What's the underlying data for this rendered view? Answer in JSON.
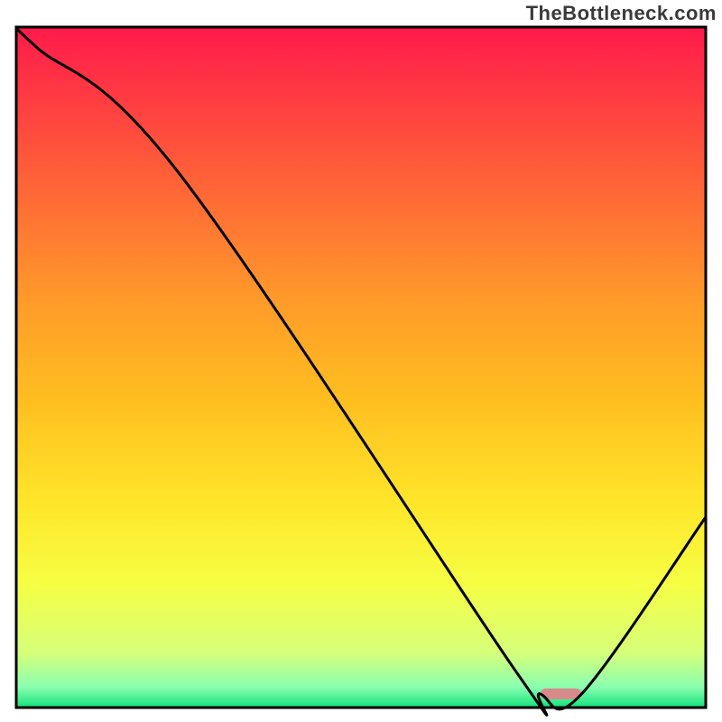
{
  "watermark": "TheBottleneck.com",
  "chart_data": {
    "type": "line",
    "title": "",
    "xlabel": "",
    "ylabel": "",
    "xlim": [
      0,
      100
    ],
    "ylim": [
      0,
      100
    ],
    "legend": false,
    "grid": false,
    "x": [
      0,
      3,
      24,
      72,
      76,
      82,
      100
    ],
    "y": [
      100,
      97,
      78,
      6,
      2,
      2,
      28
    ],
    "background_gradient": {
      "top_color": "#ff1a4b",
      "stops": [
        {
          "offset": 0.0,
          "color": "#ff1a4b"
        },
        {
          "offset": 0.2,
          "color": "#ff5a3a"
        },
        {
          "offset": 0.4,
          "color": "#ff9a2a"
        },
        {
          "offset": 0.55,
          "color": "#ffbf20"
        },
        {
          "offset": 0.7,
          "color": "#ffe62a"
        },
        {
          "offset": 0.82,
          "color": "#f5ff44"
        },
        {
          "offset": 0.92,
          "color": "#d6ff7a"
        },
        {
          "offset": 0.97,
          "color": "#8affb0"
        },
        {
          "offset": 1.0,
          "color": "#12e27a"
        }
      ]
    },
    "marker": {
      "x": 79,
      "y": 2,
      "width": 6,
      "color": "#d88a8a"
    }
  }
}
